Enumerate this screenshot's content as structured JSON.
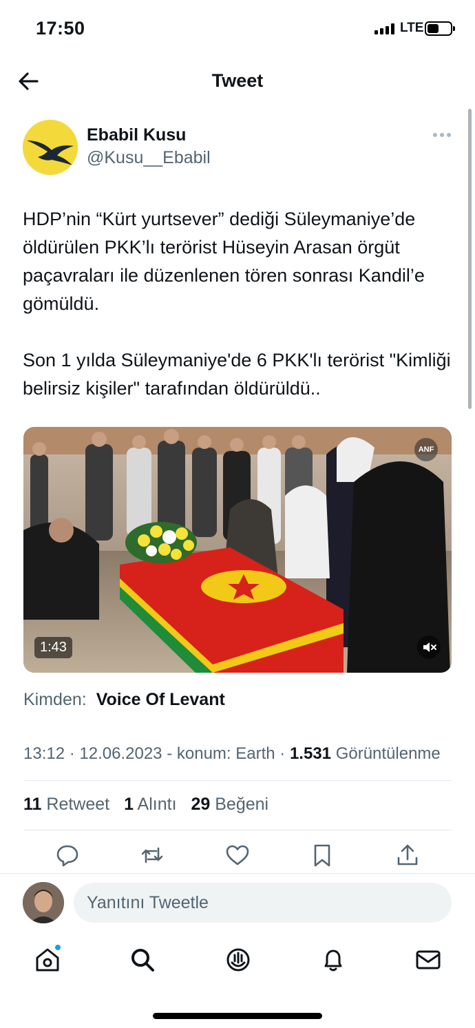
{
  "status_bar": {
    "time": "17:50",
    "network": "LTE"
  },
  "header": {
    "title": "Tweet",
    "back_icon": "arrow-left-icon"
  },
  "tweet": {
    "author": {
      "name": "Ebabil Kusu",
      "handle": "@Kusu__Ebabil",
      "avatar_icon": "swallow-bird-logo",
      "avatar_color": "#f4d93a"
    },
    "text": [
      "HDP’nin “Kürt yurtsever” dediği Süleymaniye’de öldürülen PKK’lı terörist Hüseyin Arasan örgüt paçavraları ile düzenlenen tören sonrası Kandil’e gömüldü.",
      "Son 1 yılda Süleymaniye'de 6 PKK'lı terörist \"Kimliği belirsiz kişiler\" tarafından öldürüldü.."
    ],
    "media": {
      "type": "video",
      "duration": "1:43",
      "badge": "ANF",
      "mute_icon": "speaker-muted-icon"
    },
    "source": {
      "label": "Kimden:",
      "value": "Voice Of Levant"
    },
    "meta": {
      "time": "13:12",
      "date": "12.06.2023",
      "location": "konum: Earth",
      "views_count": "1.531",
      "views_label": "Görüntülenme"
    },
    "stats": {
      "retweets_count": "11",
      "retweets_label": "Retweet",
      "quotes_count": "1",
      "quotes_label": "Alıntı",
      "likes_count": "29",
      "likes_label": "Beğeni"
    },
    "actions": [
      "reply-icon",
      "retweet-icon",
      "like-icon",
      "bookmark-icon",
      "share-icon"
    ]
  },
  "reply": {
    "placeholder": "Yanıtını Tweetle"
  },
  "tabbar": {
    "items": [
      "home-icon",
      "search-icon",
      "spaces-icon",
      "notifications-icon",
      "messages-icon"
    ],
    "accent": "#1d9bf0"
  }
}
